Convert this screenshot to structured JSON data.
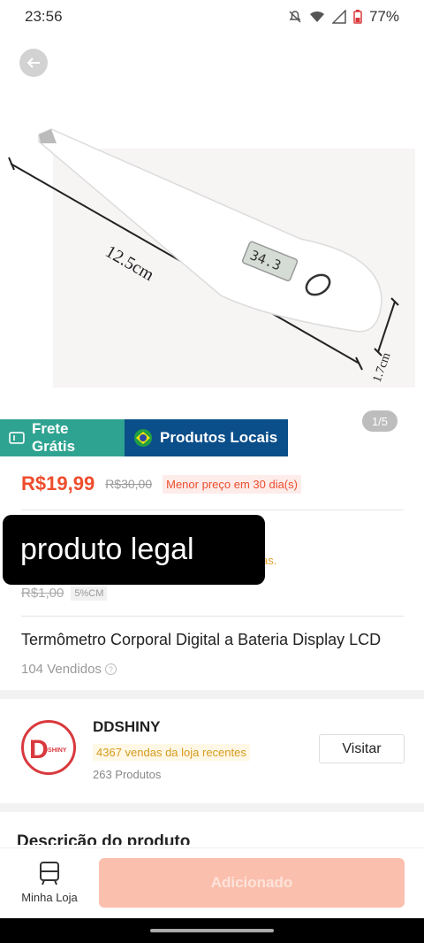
{
  "status": {
    "time": "23:56",
    "battery": "77%"
  },
  "image": {
    "dimension_length": "12.5cm",
    "dimension_width": "1.7cm",
    "display_reading": "34.3"
  },
  "pagination": "1/5",
  "badges": {
    "free_shipping": "Frete Grátis",
    "local_products": "Produtos Locais"
  },
  "price": {
    "current": "R$19,99",
    "original": "R$30,00",
    "lowest_tag": "Menor preço em 30 dia(s)"
  },
  "caption": "produto legal",
  "promo": {
    "partial_text": "as.",
    "coin_original": "R$1,00",
    "coin_tag": "5%CM"
  },
  "product": {
    "title": "Termômetro Corporal Digital a Bateria Display LCD",
    "sold": "104 Vendidos"
  },
  "store": {
    "name": "DDSHINY",
    "sales": "4367 vendas da loja recentes",
    "products": "263 Produtos",
    "visit_label": "Visitar",
    "logo_letter": "D",
    "logo_text": "DSHINY"
  },
  "description_title": "Descrição do produto",
  "bottom": {
    "my_store": "Minha Loja",
    "add_label": "Adicionado"
  },
  "colors": {
    "accent": "#ee4d2d",
    "free_shipping": "#2fa391",
    "local": "#0a4e8a",
    "add_button": "#fbbfae"
  }
}
